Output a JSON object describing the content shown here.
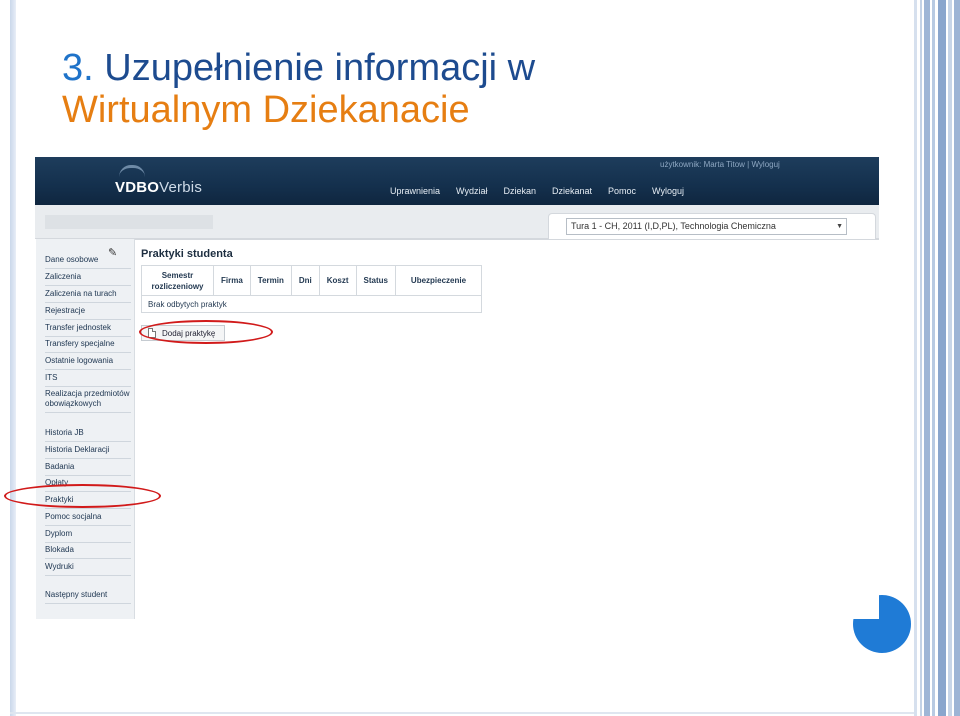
{
  "slide": {
    "title_number": "3.",
    "title_line1": "Uzupełnienie informacji w",
    "title_line2": "Wirtualnym Dziekanacie"
  },
  "app": {
    "logo_bold": "VDBO",
    "logo_light": "Verbis",
    "user_info": "użytkownik: Marta Titow  |  Wyloguj",
    "nav": [
      "Uprawnienia",
      "Wydział",
      "Dziekan",
      "Dziekanat",
      "Pomoc",
      "Wyloguj"
    ],
    "course_select": "Tura 1 - CH, 2011 (I,D,PL), Technologia Chemiczna"
  },
  "sidebar": {
    "items": [
      "Dane osobowe",
      "Zaliczenia",
      "Zaliczenia na turach",
      "Rejestracje",
      "Transfer jednostek",
      "Transfery specjalne",
      "Ostatnie logowania",
      "ITS",
      "Realizacja przedmiotów obowiązkowych",
      "Historia JB",
      "Historia Deklaracji",
      "Badania",
      "Opłaty",
      "Praktyki",
      "Pomoc socjalna",
      "Dyplom",
      "Blokada",
      "Wydruki",
      "Następny student"
    ]
  },
  "main": {
    "page_title": "Praktyki studenta",
    "columns": [
      "Semestr rozliczeniowy",
      "Firma",
      "Termin",
      "Dni",
      "Koszt",
      "Status",
      "Ubezpieczenie"
    ],
    "empty_row": "Brak odbytych praktyk",
    "add_button": "Dodaj praktykę"
  },
  "colors": {
    "title_number": "#1f73c9",
    "title_line1": "#1d4b8f",
    "title_line2": "#e67e12",
    "highlight": "#d11a1a",
    "accent_circle": "#1f7bd6"
  }
}
